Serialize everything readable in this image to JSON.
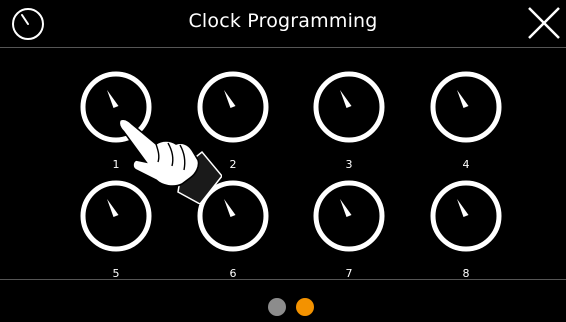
{
  "header": {
    "title": "Clock Programming",
    "left_icon": "clock-icon",
    "right_icon": "close-icon"
  },
  "clocks": [
    {
      "number": "1"
    },
    {
      "number": "2"
    },
    {
      "number": "3"
    },
    {
      "number": "4"
    },
    {
      "number": "5"
    },
    {
      "number": "6"
    },
    {
      "number": "7"
    },
    {
      "number": "8"
    }
  ],
  "pagination": {
    "pages": 2,
    "active_page": 2,
    "colors": {
      "inactive": "#8c8c8c",
      "active": "#f39200"
    }
  },
  "overlay_icon": "pointing-hand-icon",
  "colors": {
    "background": "#000000",
    "foreground": "#ffffff",
    "divider": "#555555"
  }
}
